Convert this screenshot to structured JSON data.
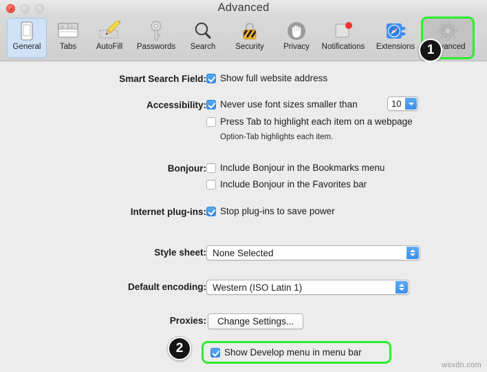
{
  "window": {
    "title": "Advanced",
    "traffic_lights": [
      "close",
      "minimize",
      "zoom"
    ]
  },
  "toolbar": {
    "items": [
      {
        "label": "General",
        "icon": "general-icon",
        "state": "selected-blue"
      },
      {
        "label": "Tabs",
        "icon": "tabs-icon",
        "state": "normal"
      },
      {
        "label": "AutoFill",
        "icon": "autofill-icon",
        "state": "normal"
      },
      {
        "label": "Passwords",
        "icon": "passwords-key-icon",
        "state": "normal"
      },
      {
        "label": "Search",
        "icon": "search-icon",
        "state": "normal"
      },
      {
        "label": "Security",
        "icon": "security-lock-icon",
        "state": "normal"
      },
      {
        "label": "Privacy",
        "icon": "privacy-hand-icon",
        "state": "normal"
      },
      {
        "label": "Notifications",
        "icon": "notifications-icon",
        "state": "normal"
      },
      {
        "label": "Extensions",
        "icon": "extensions-icon",
        "state": "normal"
      },
      {
        "label": "Advanced",
        "icon": "advanced-gear-icon",
        "state": "selected-gray"
      }
    ]
  },
  "settings": {
    "smart_search": {
      "label": "Smart Search Field:",
      "show_full_address": {
        "text": "Show full website address",
        "checked": true
      }
    },
    "accessibility": {
      "label": "Accessibility:",
      "never_use_font_sizes": {
        "text": "Never use font sizes smaller than",
        "checked": true
      },
      "font_size_value": "10",
      "press_tab": {
        "text": "Press Tab to highlight each item on a webpage",
        "checked": false
      },
      "hint": "Option-Tab highlights each item."
    },
    "bonjour": {
      "label": "Bonjour:",
      "bookmarks_menu": {
        "text": "Include Bonjour in the Bookmarks menu",
        "checked": false
      },
      "favorites_bar": {
        "text": "Include Bonjour in the Favorites bar",
        "checked": false
      }
    },
    "plugins": {
      "label": "Internet plug-ins:",
      "stop_to_save_power": {
        "text": "Stop plug-ins to save power",
        "checked": true
      }
    },
    "style_sheet": {
      "label": "Style sheet:",
      "value": "None Selected"
    },
    "default_encoding": {
      "label": "Default encoding:",
      "value": "Western (ISO Latin 1)"
    },
    "proxies": {
      "label": "Proxies:",
      "button": "Change Settings..."
    },
    "develop_menu": {
      "text": "Show Develop menu in menu bar",
      "checked": true
    }
  },
  "annotations": {
    "badge_one": "1",
    "badge_two": "2",
    "highlight_color": "#2aee2a"
  },
  "watermark": "wsxdn.com"
}
